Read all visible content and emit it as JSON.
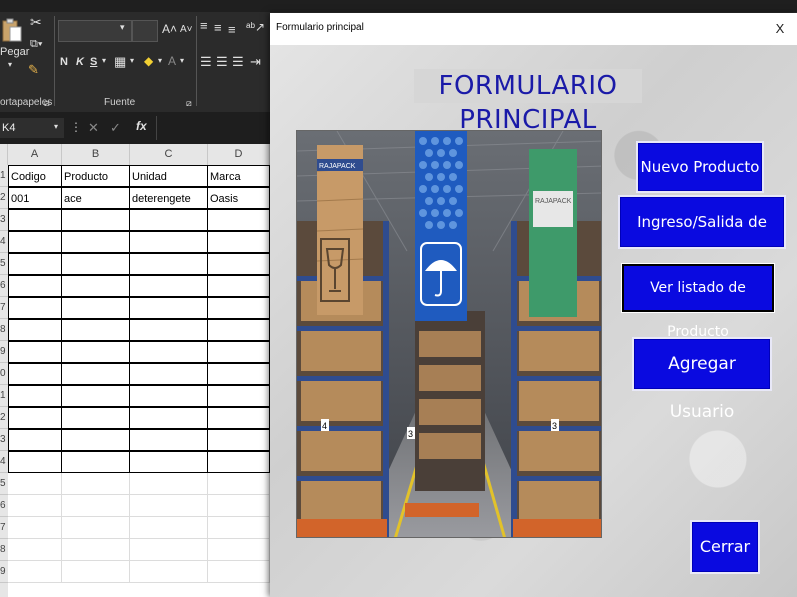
{
  "excel": {
    "clipboard": {
      "paste_label": "Pegar",
      "group_label": "ortapapeles"
    },
    "font": {
      "bold": "N",
      "italic": "K",
      "underline": "S",
      "group_label": "Fuente"
    },
    "name_box": "K4",
    "formula_fx": "fx",
    "columns": [
      "A",
      "B",
      "C",
      "D"
    ],
    "row_numbers": [
      "1",
      "2",
      "3",
      "4",
      "5",
      "6",
      "7",
      "8",
      "9",
      "0",
      "1",
      "2",
      "3",
      "4",
      "5",
      "6",
      "7",
      "8",
      "9"
    ],
    "rows": [
      [
        "Codigo",
        "Producto",
        "Unidad",
        "Marca"
      ],
      [
        "001",
        "ace",
        "deterengete",
        "Oasis"
      ]
    ]
  },
  "dialog": {
    "title": "Formulario principal",
    "close_label": "X",
    "heading": "FORMULARIO PRINCIPAL",
    "buttons": {
      "nuevo": "Nuevo Producto",
      "ingreso": "Ingreso/Salida de Producto",
      "ver": "Ver listado de Producto",
      "agregar": "Agregar Usuario",
      "cerrar": "Cerrar"
    },
    "photo": {
      "banner_left": "RAJAPACK",
      "banner_right": "RAJAPACK",
      "aisle_left": "4",
      "aisle_mid": "3",
      "aisle_right": "3"
    }
  },
  "colors": {
    "button_blue": "#0a0ae0",
    "heading_blue": "#1a1aa8",
    "excel_dark": "#2b2b2b"
  }
}
